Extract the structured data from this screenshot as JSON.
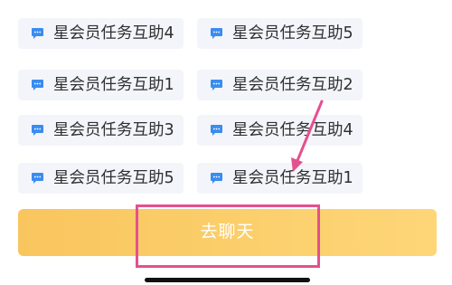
{
  "tasks": [
    {
      "label": "星会员任务互助4"
    },
    {
      "label": "星会员任务互助5"
    },
    {
      "label": "星会员任务互助1"
    },
    {
      "label": "星会员任务互助2"
    },
    {
      "label": "星会员任务互助3"
    },
    {
      "label": "星会员任务互助4"
    },
    {
      "label": "星会员任务互助5"
    },
    {
      "label": "星会员任务互助1"
    }
  ],
  "task_icon": "chat-bubble-icon",
  "chat_button": {
    "label": "去聊天"
  },
  "annotation": {
    "arrow": "pointer-arrow-icon",
    "highlight": "highlight-box"
  },
  "colors": {
    "chip_background": "#f3f5fa",
    "icon_blue": "#3a8cf0",
    "button_gradient_start": "#f9c55e",
    "button_gradient_end": "#fed678",
    "annotation_pink": "#e5508e"
  }
}
